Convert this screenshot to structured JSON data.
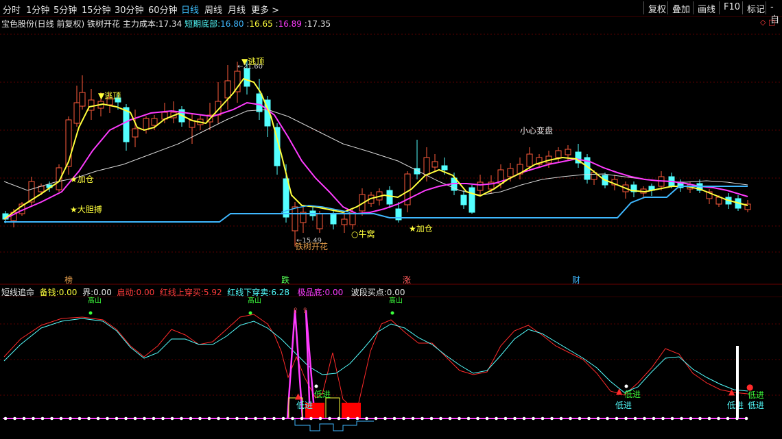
{
  "toolbar": {
    "periods": [
      "分时",
      "1分钟",
      "5分钟",
      "15分钟",
      "30分钟",
      "60分钟",
      "日线",
      "周线",
      "月线",
      "更多"
    ],
    "more_arrow": ">",
    "buttons": [
      "复权",
      "叠加",
      "画线",
      "F10",
      "标记",
      "-自"
    ]
  },
  "info": {
    "stock": "宝色股份(日线 前复权)",
    "pattern": "铁树开花",
    "cost_label": "主力成本:",
    "cost_value": "17.34",
    "bottom_label": "短期底部:",
    "v1": "16.80",
    "v2": "16.65",
    "v3": "16.89",
    "v4": "17.35",
    "corner": "◇ □"
  },
  "chart_labels": {
    "escape": "逃顶",
    "escape_price": "21.60",
    "add1": "加仓",
    "bold": "大胆搏",
    "low_price": "15.49",
    "tree": "铁树开花",
    "nest": "牛窝",
    "add2": "加仓",
    "careful": "小心变盘"
  },
  "band_labels": [
    "榜",
    "跌",
    "涨",
    "财"
  ],
  "colors": {
    "cyan": "#54ffff",
    "magenta": "#ff3cff",
    "yellow": "#ffff3c",
    "red": "#ff3b3b",
    "blue": "#3fb8ff"
  },
  "indicator": {
    "title": "短线追命",
    "beiqian_label": "备钱:",
    "beiqian_value": "0.00",
    "jie_label": "界:",
    "jie_value": "0.00",
    "qidong_label": "启动:",
    "qidong_value": "0.00",
    "up_label": "红线上穿买:",
    "up_value": "5.92",
    "down_label": "红线下穿卖:",
    "down_value": "6.28",
    "jp_label": "极品底:",
    "jp_value": "0.00",
    "bd_label": "波段买点:",
    "bd_value": "0.00"
  },
  "ind_labels": {
    "gaoshan": "高山",
    "dijin": "低进"
  }
}
